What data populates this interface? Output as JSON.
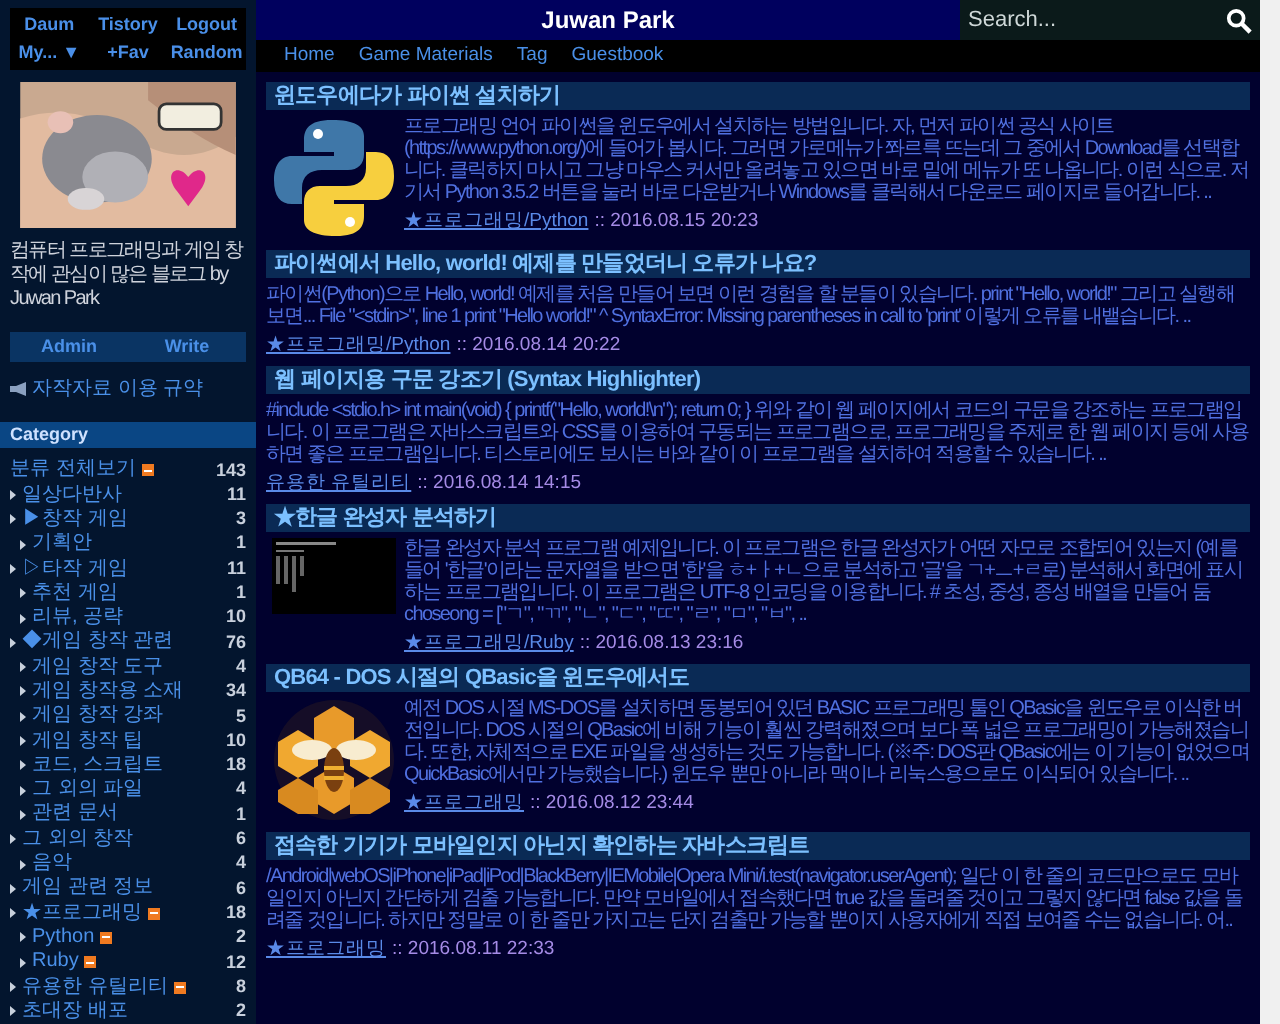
{
  "top_links": [
    "Daum",
    "Tistory",
    "Logout",
    "My... ▼",
    "+Fav",
    "Random"
  ],
  "blog_description": "컴퓨터 프로그래밍과 게임 창작에 관심이 많은 블로그 by Juwan Park",
  "admin_links": [
    "Admin",
    "Write"
  ],
  "notice_link": "자작자료 이용 규약",
  "category_heading": "Category",
  "categories": [
    {
      "label": "분류 전체보기",
      "count": "143",
      "rss": true
    },
    {
      "label": "일상다반사",
      "count": "11"
    },
    {
      "label": "▶창작 게임",
      "count": "3",
      "children": [
        {
          "label": "기획안",
          "count": "1"
        }
      ]
    },
    {
      "label": "▷타작 게임",
      "count": "11",
      "children": [
        {
          "label": "추천 게임",
          "count": "1"
        },
        {
          "label": "리뷰, 공략",
          "count": "10"
        }
      ]
    },
    {
      "label": "◆게임 창작 관련",
      "count": "76",
      "children": [
        {
          "label": "게임 창작 도구",
          "count": "4"
        },
        {
          "label": "게임 창작용 소재",
          "count": "34"
        },
        {
          "label": "게임 창작 강좌",
          "count": "5"
        },
        {
          "label": "게임 창작 팁",
          "count": "10"
        },
        {
          "label": "코드, 스크립트",
          "count": "18"
        },
        {
          "label": "그 외의 파일",
          "count": "4"
        },
        {
          "label": "관련 문서",
          "count": "1"
        }
      ]
    },
    {
      "label": "그 외의 창작",
      "count": "6",
      "children": [
        {
          "label": "음악",
          "count": "4"
        }
      ]
    },
    {
      "label": "게임 관련 정보",
      "count": "6"
    },
    {
      "label": "★프로그래밍",
      "count": "18",
      "rss": true,
      "children": [
        {
          "label": "Python",
          "count": "2",
          "rss": true
        },
        {
          "label": "Ruby",
          "count": "12",
          "rss": true
        }
      ]
    },
    {
      "label": "유용한 유틸리티",
      "count": "8",
      "rss": true
    },
    {
      "label": "초대장 배포",
      "count": "2"
    }
  ],
  "site_title": "Juwan Park",
  "search": {
    "placeholder": "Search..."
  },
  "nav": [
    "Home",
    "Game Materials",
    "Tag",
    "Guestbook"
  ],
  "posts": [
    {
      "title": "윈도우에다가 파이썬 설치하기",
      "thumbnail": {
        "kind": "python"
      },
      "excerpt": "프로그래밍 언어 파이썬을 윈도우에서 설치하는 방법입니다. 자, 먼저 파이썬 공식 사이트(https://www.python.org/)에 들어가 봅시다. 그러면 가로메뉴가 쫘르륵 뜨는데 그 중에서 Download를 선택합니다. 클릭하지 마시고 그냥 마우스 커서만 올려놓고 있으면 바로 밑에 메뉴가 또 나옵니다. 이런 식으로. 저기서 Python 3.5.2 버튼을 눌러 바로 다운받거나 Windows를 클릭해서 다운로드 페이지로 들어갑니다. ..",
      "category": "★프로그래밍/Python",
      "date": ":: 2016.08.15 20:23"
    },
    {
      "title": "파이썬에서 Hello, world! 예제를 만들었더니 오류가 나요?",
      "excerpt": "파이썬(Python)으로 Hello, world! 예제를 처음 만들어 보면 이런 경험을 할 분들이 있습니다. print \"Hello, world!\" 그리고 실행해 보면... File \"<stdin>\", line 1 print \"Hello world!\" ^ SyntaxError: Missing parentheses in call to 'print' 이렇게 오류를 내뱉습니다. ..",
      "category": "★프로그래밍/Python",
      "date": ":: 2016.08.14 20:22"
    },
    {
      "title": "웹 페이지용 구문 강조기 (Syntax Highlighter)",
      "excerpt": "#include <stdio.h> int main(void) { printf(\"Hello, world!\\n\"); return 0; } 위와 같이 웹 페이지에서 코드의 구문을 강조하는 프로그램입니다. 이 프로그램은 자바스크립트와 CSS를 이용하여 구동되는 프로그램으로, 프로그래밍을 주제로 한 웹 페이지 등에 사용하면 좋은 프로그램입니다. 티스토리에도 보시는 바와 같이 이 프로그램을 설치하여 적용할 수 있습니다. ..",
      "category": "유용한 유틸리티",
      "date": ":: 2016.08.14 14:15"
    },
    {
      "title": "★한글 완성자 분석하기",
      "thumbnail": {
        "kind": "terminal"
      },
      "excerpt": "한글 완성자 분석 프로그램 예제입니다. 이 프로그램은 한글 완성자가 어떤 자모로 조합되어 있는지 (예를 들어 '한글'이라는 문자열을 받으면 '한'을 ㅎ+ㅏ+ㄴ으로 분석하고 '글'을 ㄱ+ㅡ+ㄹ로) 분석해서 화면에 표시하는 프로그램입니다. 이 프로그램은 UTF-8 인코딩을 이용합니다. # 초성, 중성, 종성 배열을 만들어 둠 choseong = [\"ㄱ\", \"ㄲ\", \"ㄴ\", \"ㄷ\", \"ㄸ\", \"ㄹ\", \"ㅁ\", \"ㅂ\", ..",
      "category": "★프로그래밍/Ruby",
      "date": ":: 2016.08.13 23:16"
    },
    {
      "title": "QB64 - DOS 시절의 QBasic을 윈도우에서도",
      "thumbnail": {
        "kind": "bee"
      },
      "excerpt": "예전 DOS 시절 MS-DOS를 설치하면 동봉되어 있던 BASIC 프로그래밍 툴인 QBasic을 윈도우로 이식한 버전입니다. DOS 시절의 QBasic에 비해 기능이 훨씬 강력해졌으며 보다 폭 넓은 프로그래밍이 가능해졌습니다. 또한, 자체적으로 EXE 파일을 생성하는 것도 가능합니다. (※주: DOS판 QBasic에는 이 기능이 없었으며 QuickBasic에서만 가능했습니다.) 윈도우 뿐만 아니라 맥이나 리눅스용으로도 이식되어 있습니다. ..",
      "category": "★프로그래밍",
      "date": ":: 2016.08.12 23:44"
    },
    {
      "title": "접속한 기기가 모바일인지 아닌지 확인하는 자바스크립트",
      "excerpt": "/Android|webOS|iPhone|iPad|iPod|BlackBerry|IEMobile|Opera Mini/i.test(navigator.userAgent); 일단 이 한 줄의 코드만으로도 모바일인지 아닌지 간단하게 검출 가능합니다. 만약 모바일에서 접속했다면 true 값을 돌려줄 것이고 그렇지 않다면 false 값을 돌려줄 것입니다. 하지만 정말로 이 한 줄만 가지고는 단지 검출만 가능할 뿐이지 사용자에게 직접 보여줄 수는 없습니다. 어..",
      "category": "★프로그래밍",
      "date": ":: 2016.08.11 22:33"
    }
  ]
}
